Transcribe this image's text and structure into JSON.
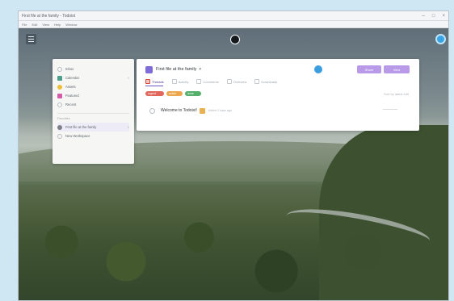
{
  "window": {
    "title": "First file at the family - Todoist",
    "menu": [
      "File",
      "Edit",
      "View",
      "Help",
      "Window"
    ],
    "controls": [
      "–",
      "□",
      "×"
    ]
  },
  "sidebar": {
    "items": [
      {
        "label": "Inbox",
        "icon": "inbox-icon",
        "color": "#b8bec3"
      },
      {
        "label": "Calendar",
        "icon": "calendar-icon",
        "color": "#4c9f8a",
        "count": "2"
      },
      {
        "label": "Assets",
        "icon": "assets-icon",
        "color": "#ecbf35"
      },
      {
        "label": "Featured",
        "icon": "featured-icon",
        "color": "#d55aa8"
      },
      {
        "label": "Recent",
        "icon": "recent-icon",
        "color": "#b8bec3"
      }
    ],
    "section_label": "Favorites",
    "projects": [
      {
        "label": "First file at the family",
        "color": "#7d7f8a",
        "count": "3"
      },
      {
        "label": "New Workspace",
        "color": "#b8bec3"
      }
    ]
  },
  "main": {
    "title": "First file at the family",
    "buttons": [
      "Share",
      "View"
    ],
    "tabs": [
      "Threads",
      "Activity",
      "Comments",
      "Overview",
      "Downloads"
    ],
    "tags": [
      "urgent",
      "active",
      "done"
    ],
    "sort_label": "Sort by latest edit",
    "task": {
      "title": "Welcome to Todoist!",
      "meta": "Added 2 days ago"
    }
  },
  "colors": {
    "accent": "#7f6cd8",
    "button": "#b89ae8",
    "link_dot": "#38a4e6"
  }
}
